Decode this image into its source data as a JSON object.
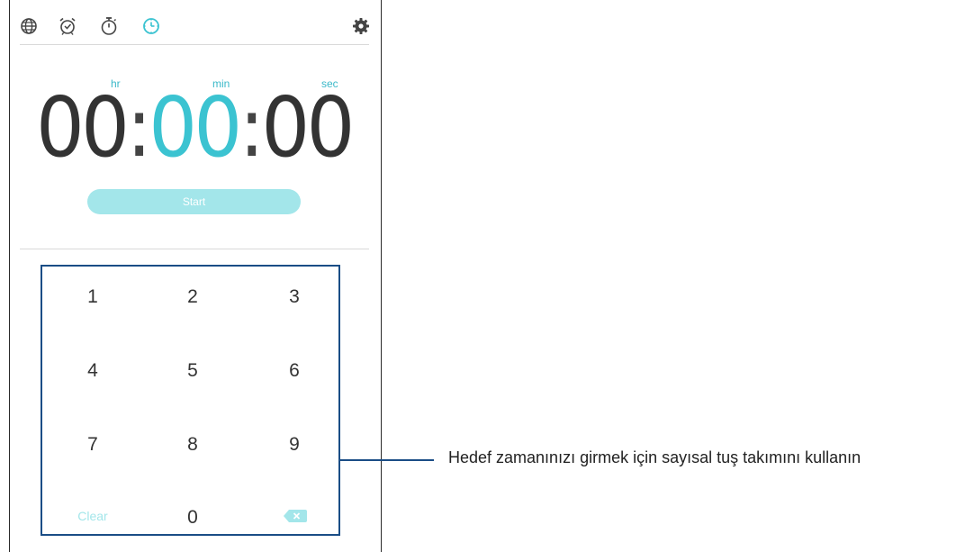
{
  "tabs": [
    {
      "name": "world-clock",
      "icon": "globe-icon",
      "active": false
    },
    {
      "name": "alarm",
      "icon": "alarm-clock-icon",
      "active": false
    },
    {
      "name": "stopwatch",
      "icon": "stopwatch-icon",
      "active": false
    },
    {
      "name": "timer",
      "icon": "timer-icon",
      "active": true
    }
  ],
  "settings_icon": "gear-icon",
  "timer": {
    "hours": "00",
    "minutes": "00",
    "seconds": "00",
    "separator": ":",
    "labels": {
      "hr": "hr",
      "min": "min",
      "sec": "sec"
    }
  },
  "start_label": "Start",
  "keypad": {
    "keys": [
      "1",
      "2",
      "3",
      "4",
      "5",
      "6",
      "7",
      "8",
      "9"
    ],
    "clear_label": "Clear",
    "zero_label": "0",
    "backspace_icon": "backspace-icon"
  },
  "callout": "Hedef zamanınızı girmek için sayısal tuş takımını kullanın",
  "colors": {
    "accent": "#3bc3d1",
    "start_button": "#a3e6ea",
    "callout_line": "#1a4d86",
    "icon_gray": "#444444"
  }
}
